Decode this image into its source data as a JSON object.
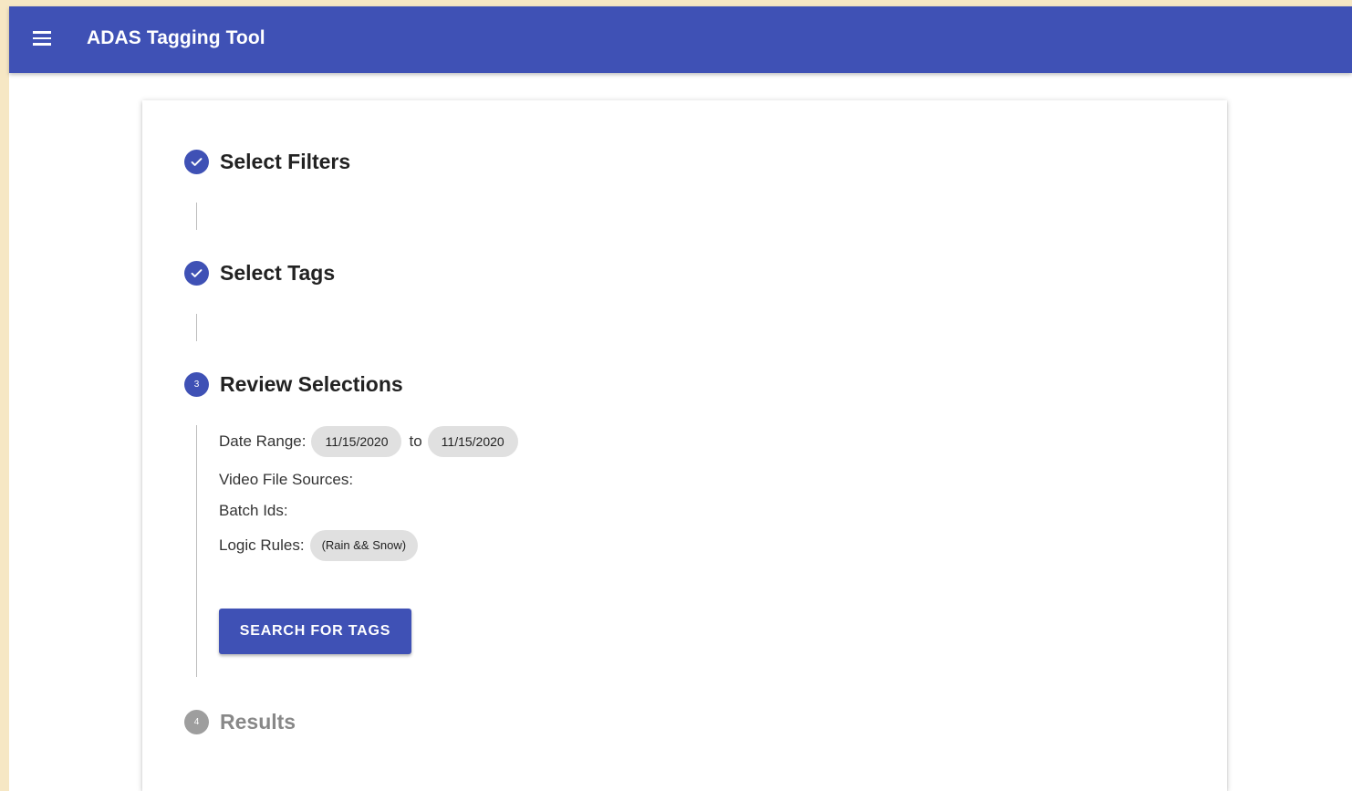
{
  "app": {
    "title": "ADAS Tagging Tool"
  },
  "colors": {
    "primary": "#3f51b5",
    "pending": "#9e9e9e"
  },
  "steps": [
    {
      "label": "Select Filters",
      "state": "completed",
      "icon": "check-circle-icon",
      "number": "1"
    },
    {
      "label": "Select Tags",
      "state": "completed",
      "icon": "check-circle-icon",
      "number": "2"
    },
    {
      "label": "Review Selections",
      "state": "active",
      "icon": "step-number-icon",
      "number": "3"
    },
    {
      "label": "Results",
      "state": "pending",
      "icon": "step-number-icon",
      "number": "4"
    }
  ],
  "review": {
    "date_range_label": "Date Range:",
    "date_from": "11/15/2020",
    "to_text": "to",
    "date_to": "11/15/2020",
    "video_sources_label": "Video File Sources:",
    "batch_ids_label": "Batch Ids:",
    "logic_rules_label": "Logic Rules:",
    "logic_rule": "(Rain && Snow)",
    "search_button": "SEARCH FOR TAGS"
  }
}
